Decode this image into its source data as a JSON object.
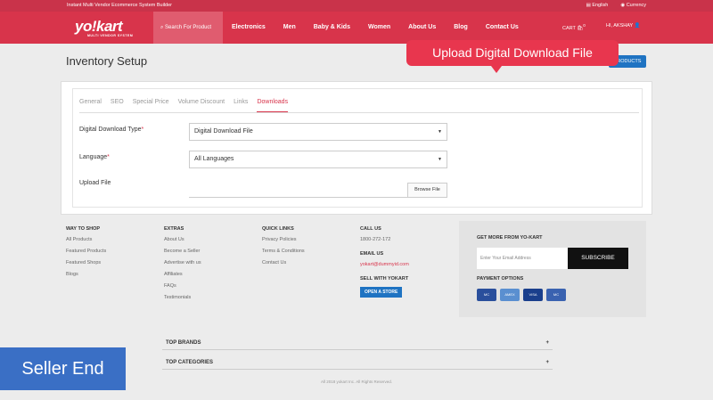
{
  "topbar": {
    "tagline": "Instant Multi Vendor Ecommerce System Builder",
    "language": "English",
    "currency": "Currency"
  },
  "header": {
    "logo": "yo!kart",
    "logo_sub": "MULTI VENDOR SYSTEM",
    "search_placeholder": "Search For Product",
    "nav": [
      "Electronics",
      "Men",
      "Baby & Kids",
      "Women",
      "About Us",
      "Blog",
      "Contact Us"
    ],
    "cart_label": "CART",
    "cart_count": "0",
    "user_label": "HI, AKSHAY"
  },
  "page": {
    "title": "Inventory Setup",
    "products_button": "PRODUCTS"
  },
  "callout": "Upload Digital Download File",
  "tabs": [
    "General",
    "SEO",
    "Special Price",
    "Volume Discount",
    "Links",
    "Downloads"
  ],
  "form": {
    "download_type_label": "Digital Download Type",
    "download_type_value": "Digital Download File",
    "language_label": "Language",
    "language_value": "All Languages",
    "upload_label": "Upload File",
    "browse_label": "Browse File",
    "required_mark": "*"
  },
  "footer": {
    "way_to_shop": {
      "title": "WAY TO SHOP",
      "items": [
        "All Products",
        "Featured Products",
        "Featured Shops",
        "Blogs"
      ]
    },
    "extras": {
      "title": "EXTRAS",
      "items": [
        "About Us",
        "Become a Seller",
        "Advertise with us",
        "Affiliates",
        "FAQs",
        "Testimonials"
      ]
    },
    "quick_links": {
      "title": "QUICK LINKS",
      "items": [
        "Privacy Policies",
        "Terms & Conditions",
        "Contact Us"
      ]
    },
    "call_us": {
      "title": "CALL US",
      "phone": "1800-272-172"
    },
    "email_us": {
      "title": "EMAIL US",
      "email": "yokart@dummyid.com"
    },
    "sell": {
      "title": "SELL WITH YOKART",
      "button": "OPEN A STORE"
    },
    "newsletter": {
      "title": "GET MORE FROM YO-KART",
      "placeholder": "Enter Your Email Address",
      "button": "SUBSCRIBE"
    },
    "payment": {
      "title": "PAYMENT OPTIONS",
      "cards": [
        "MC",
        "AMEX",
        "VISA",
        "MC"
      ]
    },
    "top_brands": "TOP BRANDS",
    "top_categories": "TOP CATEGORIES",
    "copyright": "All 2018 yokart Inc. All Rights Reserved."
  },
  "badge": "Seller End",
  "colors": {
    "brand": "#d8344b",
    "accent_blue": "#1f73c2"
  }
}
